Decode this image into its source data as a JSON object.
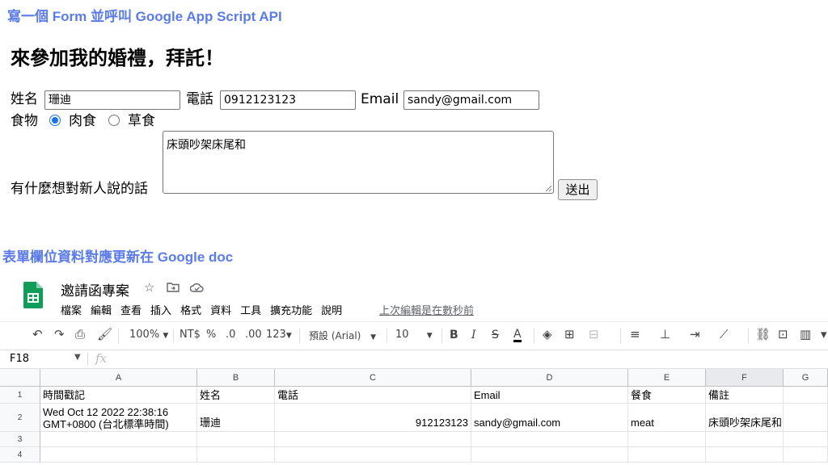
{
  "sections": {
    "form_title": "寫一個 Form 並呼叫 Google App Script API",
    "sheet_title": "表單欄位資料對應更新在 Google doc"
  },
  "form": {
    "heading": "來參加我的婚禮，拜託！",
    "name_label": "姓名",
    "name_value": "珊迪",
    "phone_label": "電話",
    "phone_value": "0912123123",
    "email_label": "Email",
    "email_value": "sandy@gmail.com",
    "food_label": "食物",
    "option_meat": "肉食",
    "option_veg": "草食",
    "selected_food": "meat",
    "message_label": "有什麼想對新人說的話",
    "message_value": "床頭吵架床尾和",
    "submit_label": "送出"
  },
  "sheets": {
    "doc_title": "邀請函專案",
    "menu": [
      "檔案",
      "編輯",
      "查看",
      "插入",
      "格式",
      "資料",
      "工具",
      "擴充功能",
      "說明"
    ],
    "last_edit": "上次編輯是在數秒前",
    "toolbar": {
      "zoom": "100%",
      "currency": "NT$",
      "percent": "%",
      "dec_less": ".0",
      "dec_more": ".00",
      "number_format": "123",
      "font": "預設 (Arial)",
      "font_size": "10"
    },
    "name_box": "F18",
    "fx": "fx",
    "columns": [
      "A",
      "B",
      "C",
      "D",
      "E",
      "F",
      "G"
    ],
    "rows": [
      "1",
      "2",
      "3",
      "4"
    ],
    "header_row": [
      "時間戳記",
      "姓名",
      "電話",
      "Email",
      "餐食",
      "備註"
    ],
    "data_row": {
      "timestamp_line1": "Wed Oct 12 2022 22:38:16",
      "timestamp_line2": "GMT+0800 (台北標準時間)",
      "name": "珊迪",
      "phone": "912123123",
      "email": "sandy@gmail.com",
      "meal": "meat",
      "note": "床頭吵架床尾和"
    }
  },
  "colors": {
    "section_title": "#5b7be8",
    "radio_accent": "#1a73e8",
    "sheets_green": "#0f9d58"
  }
}
